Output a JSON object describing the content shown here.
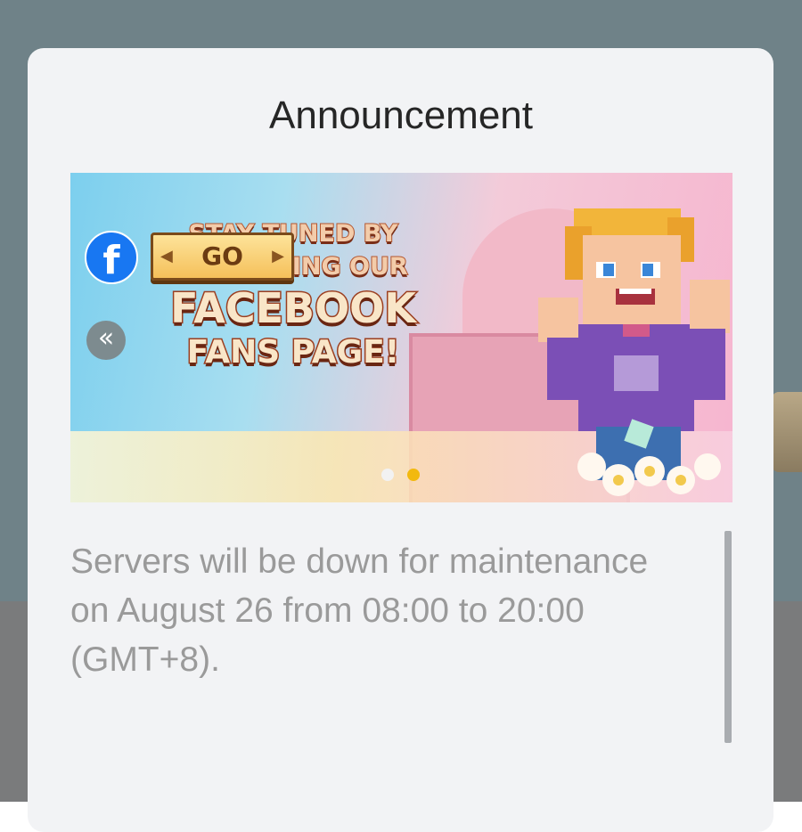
{
  "dialog": {
    "title": "Announcement",
    "message": "Servers will be down for maintenance on August 26 from 08:00 to 20:00 (GMT+8)."
  },
  "banner": {
    "line1": "STAY TUNED BY",
    "line2": "FOLLOWING OUR",
    "line3": "FACEBOOK",
    "line4": "FANS PAGE!",
    "go_label": "GO",
    "facebook_glyph": "f",
    "prev_glyph": "«",
    "carousel": {
      "total_slides": 2,
      "active_slide": 2
    }
  },
  "colors": {
    "backdrop": "#6f8288",
    "dialog_bg": "#f2f3f5",
    "title_text": "#262626",
    "message_text": "#9a9a9a",
    "facebook_blue": "#1877f2",
    "active_dot": "#f2b90f"
  },
  "icons": {
    "prev": "double-chevron-left-icon",
    "facebook": "facebook-icon"
  }
}
